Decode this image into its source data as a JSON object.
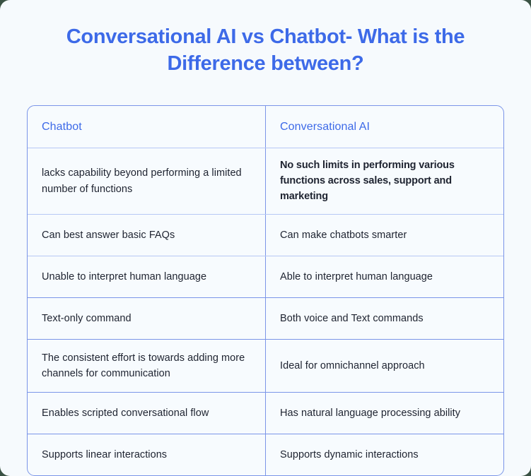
{
  "page": {
    "title": "Conversational AI vs Chatbot- What is the Difference between?",
    "background_color": "#f6fafd",
    "accent_color": "#3d6ae8",
    "border_color": "#7b95e8",
    "text_color": "#1e2330"
  },
  "table": {
    "headers": [
      "Chatbot",
      "Conversational AI"
    ],
    "rows": [
      {
        "chatbot": "lacks capability beyond performing a limited number of functions",
        "conversational_ai": "No such limits in performing various functions across sales, support and marketing"
      },
      {
        "chatbot": "Can best answer basic FAQs",
        "conversational_ai": "Can make chatbots smarter"
      },
      {
        "chatbot": "Unable to interpret human language",
        "conversational_ai": "Able to interpret human language"
      },
      {
        "chatbot": "Text-only command",
        "conversational_ai": "Both voice and Text commands"
      },
      {
        "chatbot": "The consistent effort is towards adding more channels for communication",
        "conversational_ai": "Ideal for omnichannel approach"
      },
      {
        "chatbot": "Enables scripted conversational flow",
        "conversational_ai": "Has natural language processing ability"
      },
      {
        "chatbot": "Supports linear interactions",
        "conversational_ai": "Supports dynamic interactions"
      }
    ]
  }
}
